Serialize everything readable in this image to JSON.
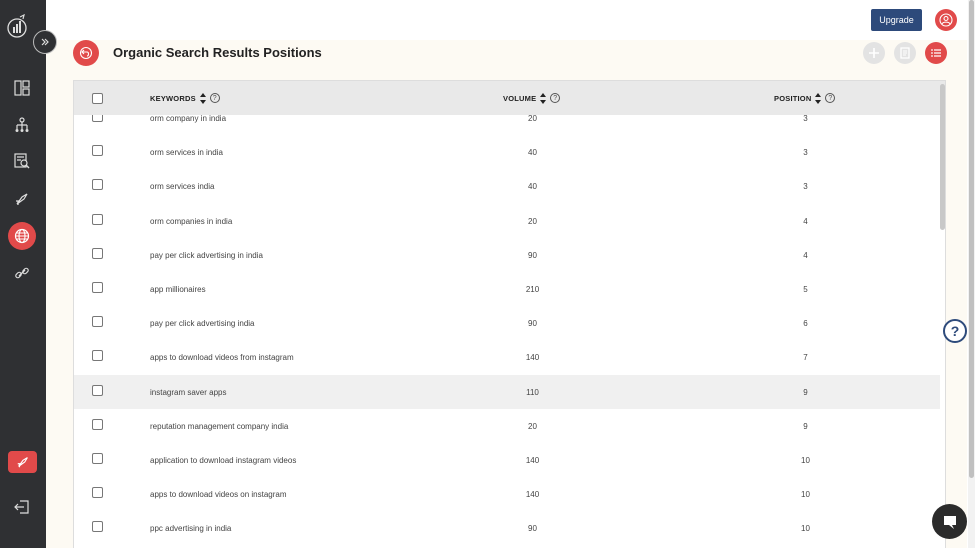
{
  "window": {
    "upgrade_label": "Upgrade"
  },
  "page": {
    "title": "Organic Search Results Positions"
  },
  "sidebar": {
    "items": [
      {
        "icon": "dashboard-icon"
      },
      {
        "icon": "hierarchy-icon"
      },
      {
        "icon": "search-report-icon"
      },
      {
        "icon": "rocket-icon"
      },
      {
        "icon": "globe-icon",
        "active": true
      },
      {
        "icon": "link-icon"
      },
      {
        "icon": "rocket-badge-icon"
      },
      {
        "icon": "logout-icon"
      }
    ]
  },
  "table": {
    "columns": {
      "keywords": "KEYWORDS",
      "volume": "VOLUME",
      "position": "POSITION"
    },
    "rows": [
      {
        "keyword": "orm company in india",
        "volume": "20",
        "position": "3"
      },
      {
        "keyword": "orm services in india",
        "volume": "40",
        "position": "3"
      },
      {
        "keyword": "orm services india",
        "volume": "40",
        "position": "3"
      },
      {
        "keyword": "orm companies in india",
        "volume": "20",
        "position": "4"
      },
      {
        "keyword": "pay per click advertising in india",
        "volume": "90",
        "position": "4"
      },
      {
        "keyword": "app millionaires",
        "volume": "210",
        "position": "5"
      },
      {
        "keyword": "pay per click advertising india",
        "volume": "90",
        "position": "6"
      },
      {
        "keyword": "apps to download videos from instagram",
        "volume": "140",
        "position": "7"
      },
      {
        "keyword": "instagram saver apps",
        "volume": "110",
        "position": "9"
      },
      {
        "keyword": "reputation management company india",
        "volume": "20",
        "position": "9"
      },
      {
        "keyword": "application to download instagram videos",
        "volume": "140",
        "position": "10"
      },
      {
        "keyword": "apps to download videos on instagram",
        "volume": "140",
        "position": "10"
      },
      {
        "keyword": "ppc advertising in india",
        "volume": "90",
        "position": "10"
      }
    ]
  },
  "colors": {
    "accent_red": "#e14a4a",
    "upgrade_blue": "#2d4a7b",
    "sidebar_bg": "#2f3033",
    "content_bg": "#fdfaf3"
  }
}
